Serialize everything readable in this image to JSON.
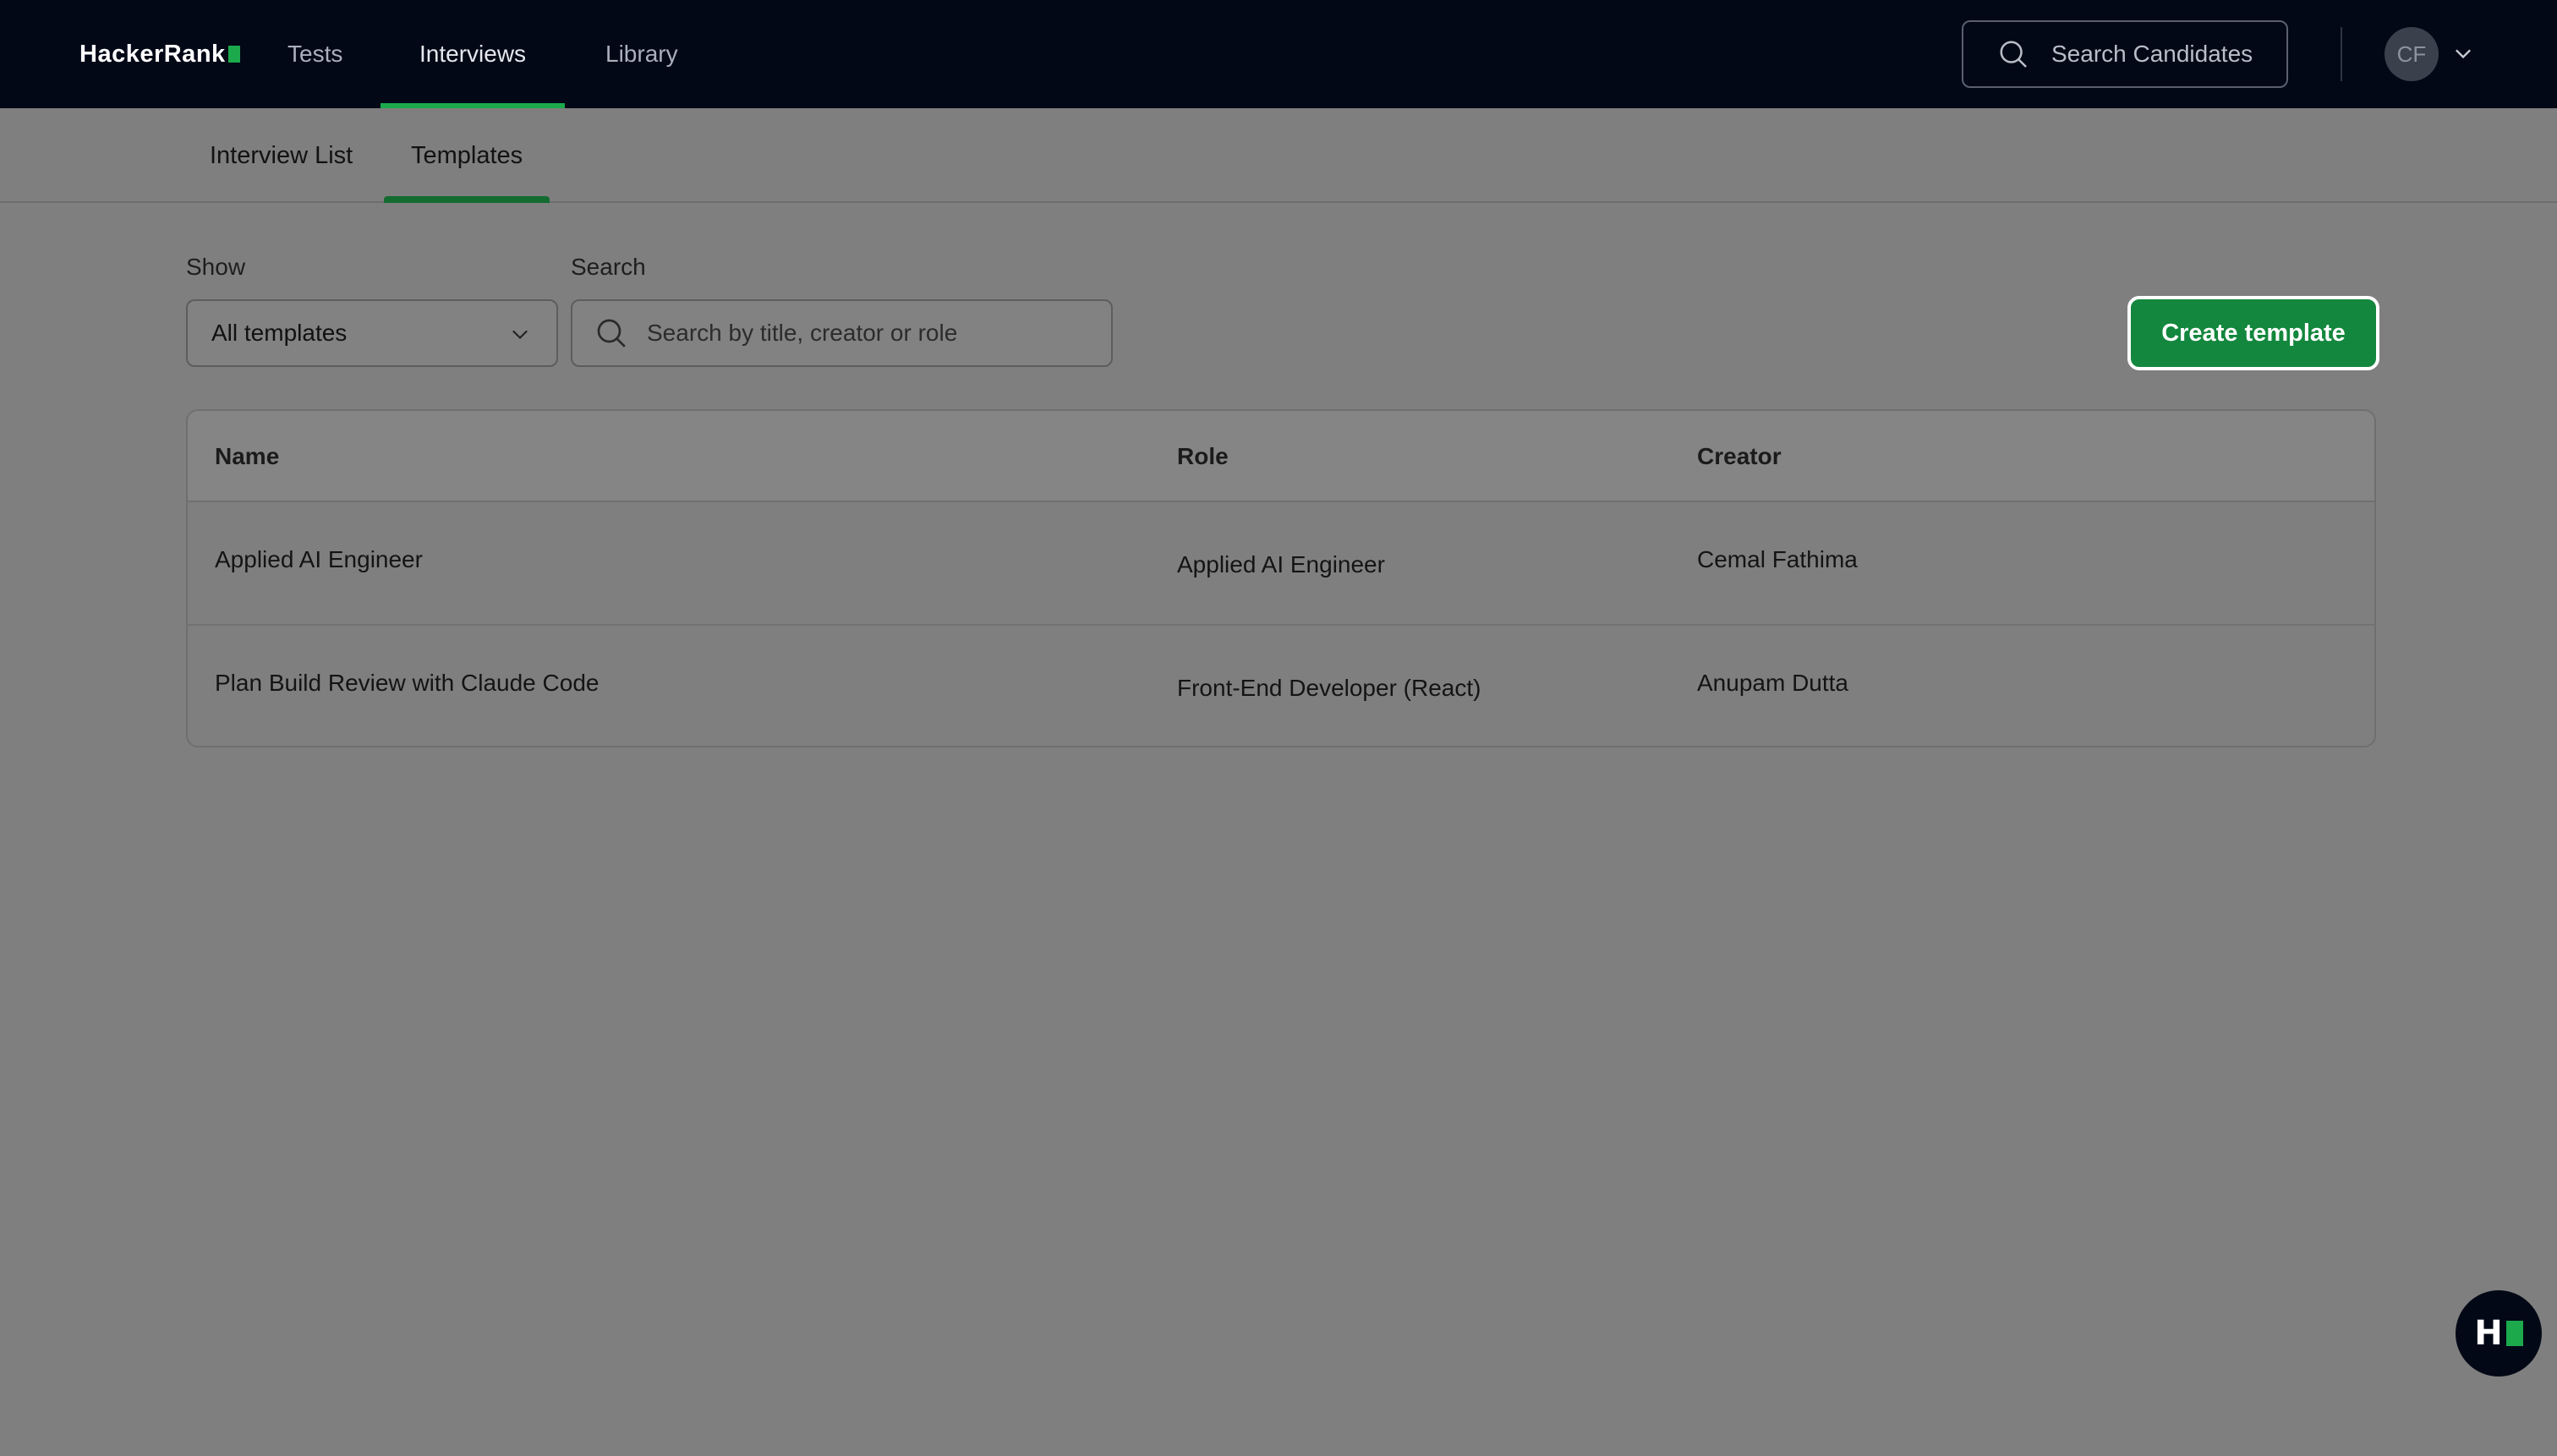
{
  "nav": {
    "logo": "HackerRank",
    "tests": "Tests",
    "interviews": "Interviews",
    "library": "Library",
    "search_candidates": "Search Candidates",
    "avatar_initials": "CF",
    "accent_color": "#1ba94c"
  },
  "subtabs": {
    "interview_list": "Interview List",
    "templates": "Templates",
    "active": "Templates"
  },
  "filters": {
    "show_label": "Show",
    "show_value": "All templates",
    "search_label": "Search",
    "search_placeholder": "Search by title, creator or role",
    "create_button": "Create template"
  },
  "table": {
    "columns": [
      "Name",
      "Role",
      "Creator"
    ],
    "rows": [
      {
        "name": "Applied AI Engineer",
        "role": "Applied AI Engineer",
        "creator": "Cemal Fathima"
      },
      {
        "name": "Plan Build Review with Claude Code",
        "role": "Front-End Developer (React)",
        "creator": "Anupam Dutta"
      }
    ]
  },
  "fab": {
    "letter": "H"
  },
  "icons": [
    "search-icon",
    "chevron-down-icon",
    "hackerrank-logo-icon"
  ]
}
